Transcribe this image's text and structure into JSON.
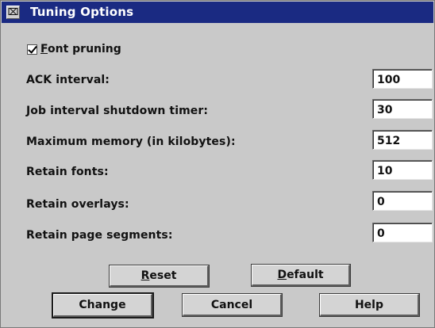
{
  "window": {
    "title": "Tuning Options",
    "system_menu_glyph": "⌧"
  },
  "font_pruning": {
    "mnemonic": "F",
    "rest": "ont pruning",
    "checked": true
  },
  "fields": {
    "ack_interval": {
      "label": "ACK interval:",
      "value": "100"
    },
    "job_interval_shutdown_timer": {
      "label": "Job interval shutdown timer:",
      "value": "30"
    },
    "maximum_memory": {
      "label": "Maximum memory (in kilobytes):",
      "value": "512"
    },
    "retain_fonts": {
      "label": "Retain fonts:",
      "value": "10"
    },
    "retain_overlays": {
      "label": "Retain overlays:",
      "value": "0"
    },
    "retain_page_segments": {
      "label": "Retain page segments:",
      "value": "0"
    }
  },
  "buttons": {
    "reset": {
      "mnemonic": "R",
      "rest": "eset"
    },
    "default": {
      "mnemonic": "D",
      "rest": "efault"
    },
    "change": {
      "label": "Change"
    },
    "cancel": {
      "label": "Cancel"
    },
    "help": {
      "label": "Help"
    }
  },
  "icons": {
    "system_menu": "system-menu-icon",
    "checkbox": "checkmark-icon"
  }
}
